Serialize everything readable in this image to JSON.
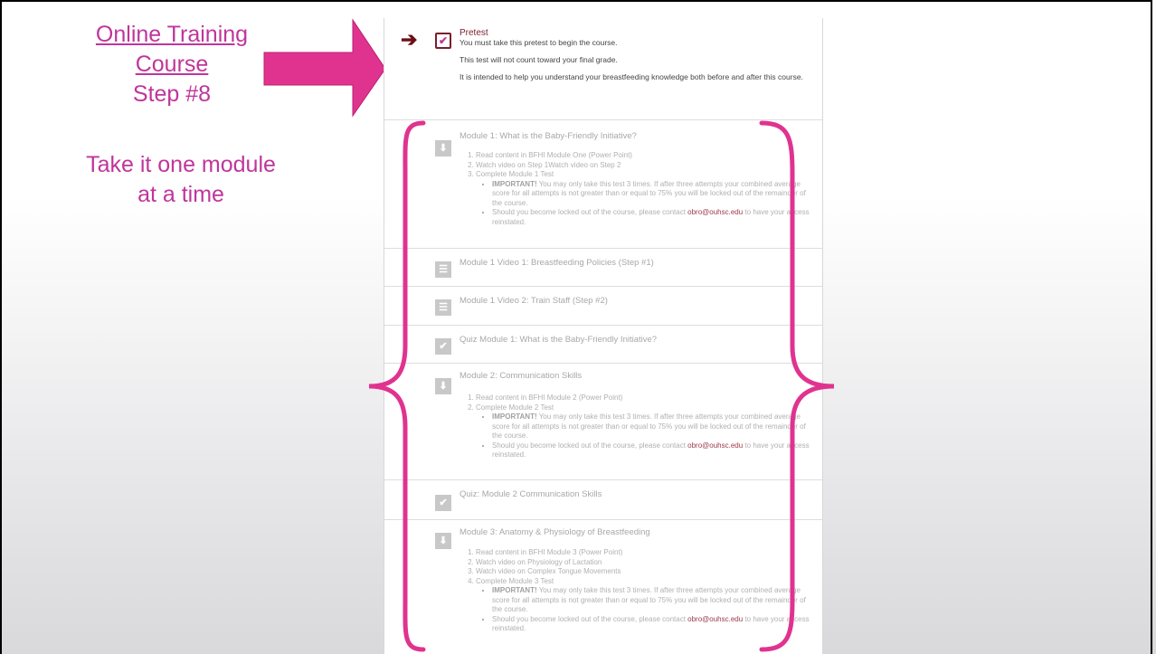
{
  "slide": {
    "title_link_line1": "Online Training",
    "title_link_line2": "Course",
    "title_step": "Step #8",
    "tagline_line1": "Take it one module",
    "tagline_line2": "at a time"
  },
  "pretest": {
    "title": "Pretest",
    "line1": "You must take this pretest to begin the course.",
    "line2": "This test will not count toward your final grade.",
    "line3": "It is intended to help you understand your breastfeeding knowledge both before and after this course."
  },
  "sections": [
    {
      "title": "Module 1: What is the Baby-Friendly Initiative?",
      "icon": "download-icon",
      "steps": [
        "Read content in BFHI Module One (Power Point)",
        "Watch video on Step 1Watch video on Step 2",
        "Complete Module 1 Test"
      ],
      "bullets": [
        "You may only take this test 3 times. If after three attempts your combined average score for all attempts is not greater than or equal to 75% you will be locked out of the remainder of the course.",
        "Should you become locked out of the course, please contact "
      ]
    },
    {
      "title": "Module 1 Video 1: Breastfeeding Policies (Step #1)",
      "icon": "page-icon"
    },
    {
      "title": "Module 1 Video 2: Train Staff (Step #2)",
      "icon": "page-icon"
    },
    {
      "title": "Quiz Module 1: What is the Baby-Friendly Initiative?",
      "icon": "check-icon"
    },
    {
      "title": "Module 2: Communication Skills",
      "icon": "download-icon",
      "steps": [
        "Read content in BFHI Module 2 (Power Point)",
        "Complete Module 2 Test"
      ]
    },
    {
      "title": "Quiz: Module 2 Communication Skills",
      "icon": "check-icon"
    },
    {
      "title": "Module 3: Anatomy & Physiology of Breastfeeding",
      "icon": "download-icon",
      "steps": [
        "Read content in BFHI Module 3 (Power Point)",
        "Watch video on Physiology of Lactation",
        "Watch video on Complex Tongue Movements",
        "Complete Module 3 Test"
      ]
    }
  ],
  "common": {
    "important_label": "IMPORTANT!",
    "important_text": " You may only take this test 3 times. If after three attempts your combined average score for all attempts is not greater than or equal to 75% you will be locked out of the remainder of the course.",
    "locked_text": "Should you become locked out of the course, please contact ",
    "email": "obro@ouhsc.edu",
    "locked_tail": " to have your access reinstated."
  },
  "colors": {
    "accent_pink": "#e0338f",
    "text_pink": "#c0359b",
    "maroon": "#7a1f2b"
  }
}
